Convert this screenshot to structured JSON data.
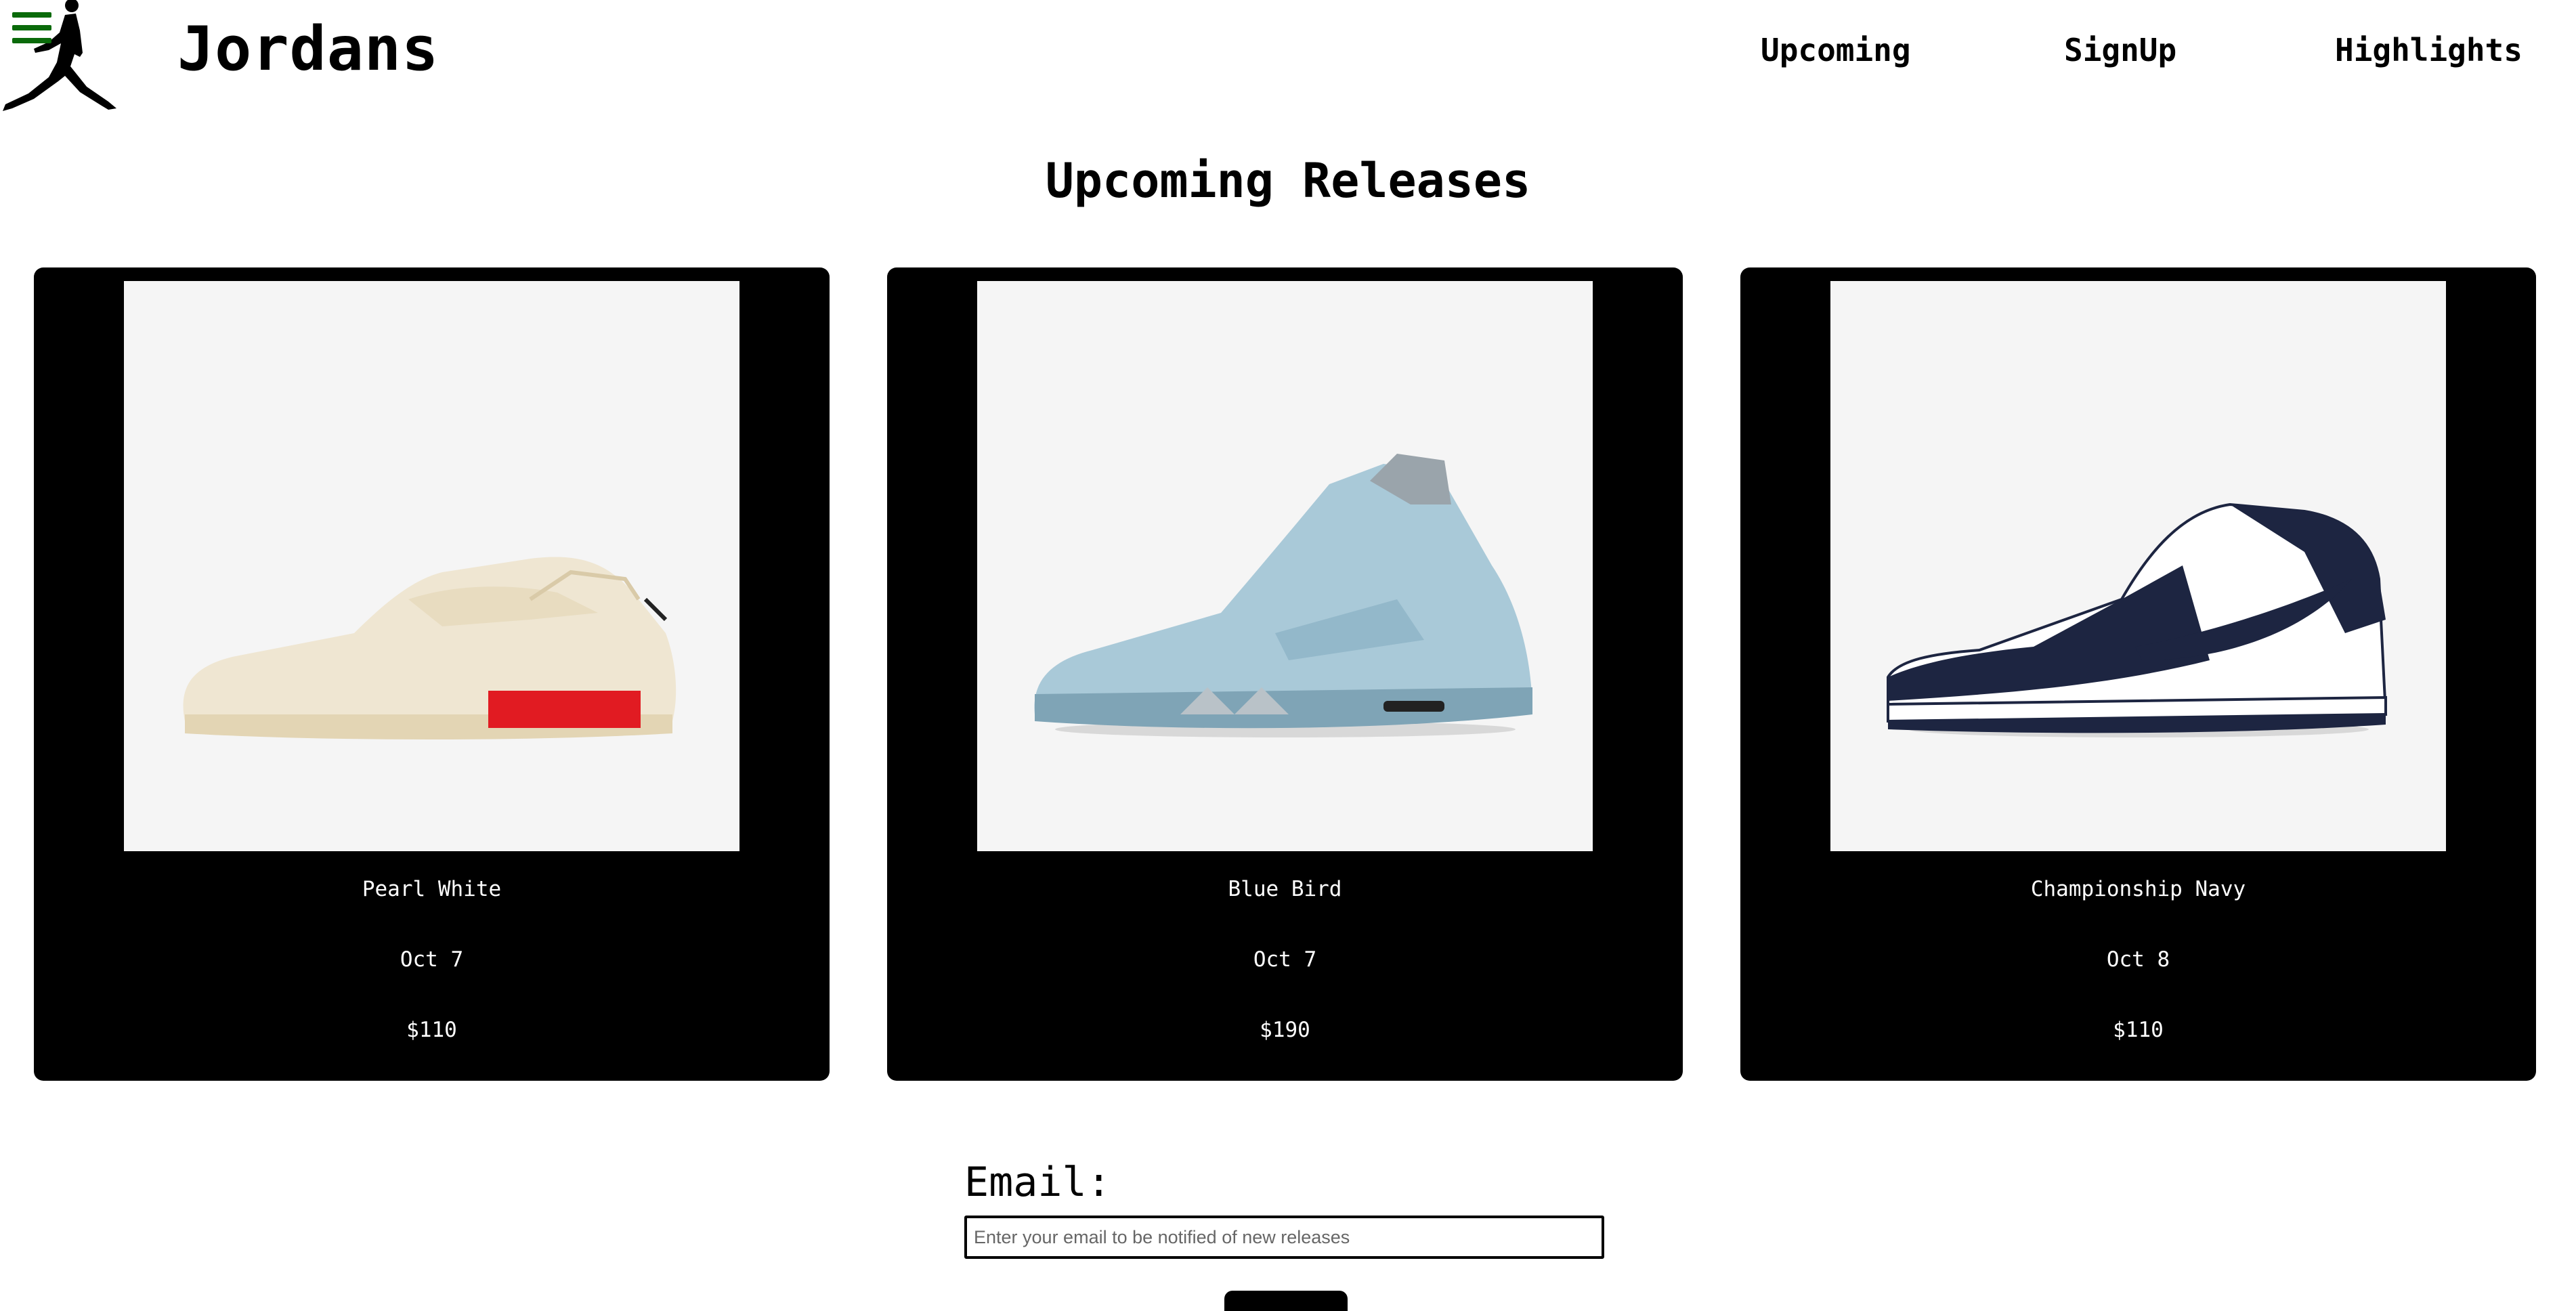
{
  "header": {
    "brand": "Jordans",
    "nav": [
      {
        "label": "Upcoming"
      },
      {
        "label": "SignUp"
      },
      {
        "label": "Highlights"
      }
    ],
    "menu_icon": "hamburger-menu-icon",
    "logo_icon": "jumpman-logo-icon",
    "menu_color": "#0a6a0a"
  },
  "main": {
    "title": "Upcoming Releases",
    "cards": [
      {
        "name": "Pearl White",
        "date": "Oct 7",
        "price": "$110",
        "image": "sneaker-pearl-white-image"
      },
      {
        "name": "Blue Bird",
        "date": "Oct 7",
        "price": "$190",
        "image": "sneaker-blue-bird-image"
      },
      {
        "name": "Championship Navy",
        "date": "Oct 8",
        "price": "$110",
        "image": "sneaker-championship-navy-image"
      }
    ]
  },
  "signup": {
    "label": "Email:",
    "placeholder": "Enter your email to be notified of new releases"
  }
}
